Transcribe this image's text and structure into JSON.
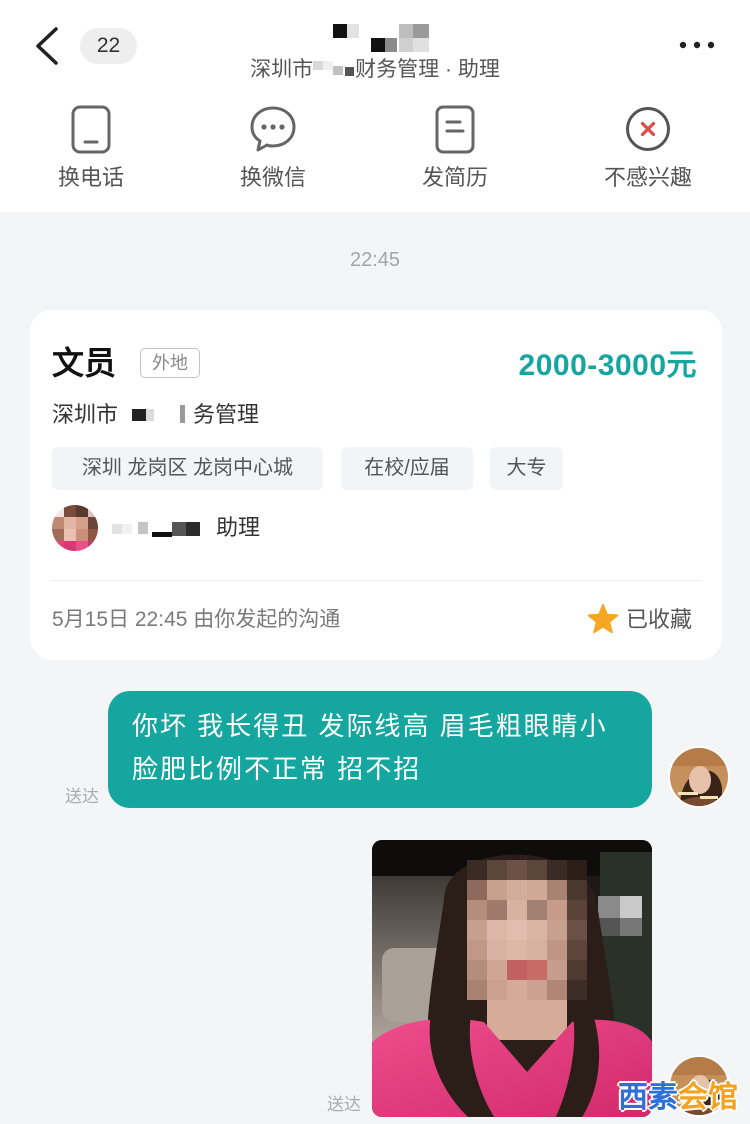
{
  "header": {
    "unread_count": "22",
    "subtitle_prefix": "深圳市",
    "subtitle_suffix": "财务管理 · 助理",
    "icons": {
      "back": "chevron-left-icon",
      "more": "more-dots-icon"
    }
  },
  "actions": [
    {
      "label": "换电话",
      "icon": "phone-icon"
    },
    {
      "label": "换微信",
      "icon": "wechat-icon"
    },
    {
      "label": "发简历",
      "icon": "resume-icon"
    },
    {
      "label": "不感兴趣",
      "icon": "not-interested-icon"
    }
  ],
  "timestamp": "22:45",
  "job_card": {
    "title": "文员",
    "location_tag": "外地",
    "salary": "2000-3000元",
    "company_prefix": "深圳市",
    "company_suffix": "务管理",
    "tags": [
      "深圳 龙岗区 龙岗中心城",
      "在校/应届",
      "大专"
    ],
    "recruiter_role": "助理",
    "started_at": "5月15日 22:45 由你发起的沟通",
    "favorite_label": "已收藏",
    "favorite_icon": "star-icon"
  },
  "messages": [
    {
      "lines": [
        "你坏 我长得丑 发际线高 眉毛粗眼睛小",
        "脸肥比例不正常 招不招"
      ],
      "status": "送达"
    },
    {
      "status": "送达"
    }
  ],
  "watermark": {
    "part1": "西素",
    "part2": "会馆"
  },
  "colors": {
    "accent": "#16a6a0",
    "favorite": "#f5a623",
    "dislike": "#e54848",
    "background": "#f4f5f7"
  }
}
